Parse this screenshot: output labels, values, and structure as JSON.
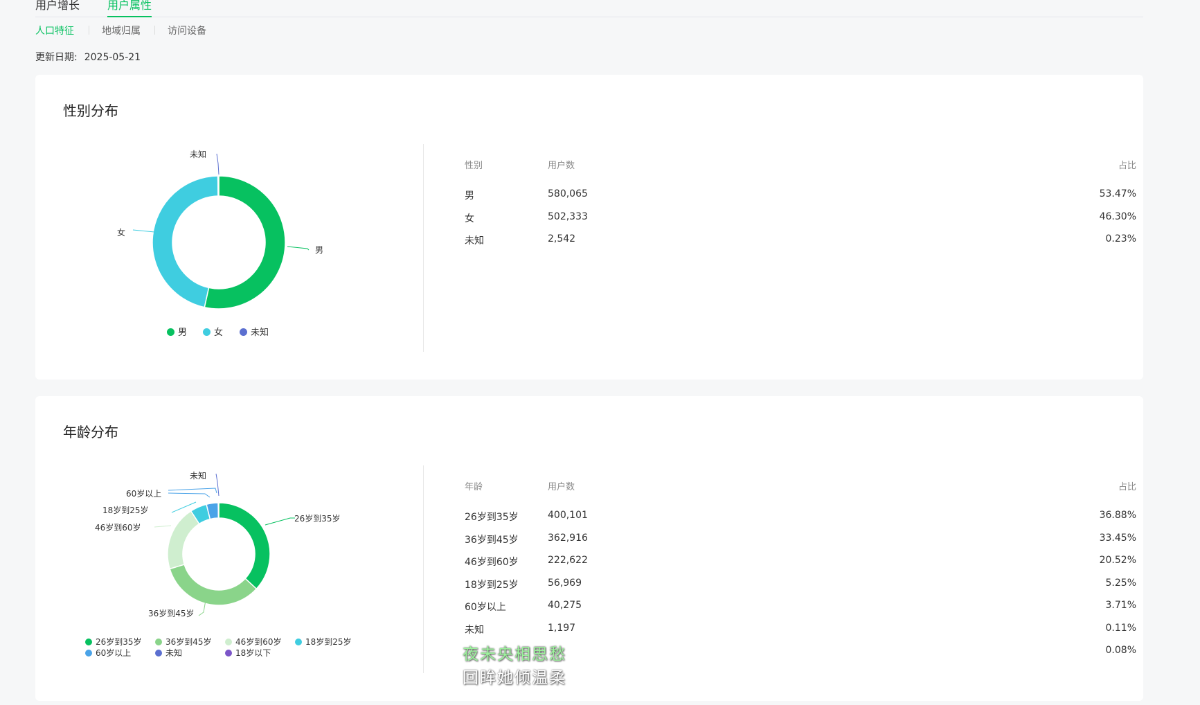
{
  "tabs": [
    {
      "label": "用户增长",
      "active": false
    },
    {
      "label": "用户属性",
      "active": true
    }
  ],
  "subtabs": [
    {
      "label": "人口特征",
      "active": true
    },
    {
      "label": "地域归属",
      "active": false
    },
    {
      "label": "访问设备",
      "active": false
    }
  ],
  "update": {
    "label": "更新日期:",
    "value": "2025-05-21"
  },
  "gender": {
    "title": "性别分布",
    "table": {
      "headers": [
        "性别",
        "用户数",
        "占比"
      ],
      "rows": [
        {
          "label": "男",
          "count": "580,065",
          "pct": "53.47%"
        },
        {
          "label": "女",
          "count": "502,333",
          "pct": "46.30%"
        },
        {
          "label": "未知",
          "count": "2,542",
          "pct": "0.23%"
        }
      ]
    },
    "chart_data": {
      "type": "pie",
      "categories": [
        "男",
        "女",
        "未知"
      ],
      "values": [
        53.47,
        46.3,
        0.23
      ],
      "colors": [
        "#07c160",
        "#3fcde0",
        "#5b6fd0"
      ],
      "legend_placement": "bottom"
    }
  },
  "age": {
    "title": "年龄分布",
    "table": {
      "headers": [
        "年龄",
        "用户数",
        "占比"
      ],
      "rows": [
        {
          "label": "26岁到35岁",
          "count": "400,101",
          "pct": "36.88%"
        },
        {
          "label": "36岁到45岁",
          "count": "362,916",
          "pct": "33.45%"
        },
        {
          "label": "46岁到60岁",
          "count": "222,622",
          "pct": "20.52%"
        },
        {
          "label": "18岁到25岁",
          "count": "56,969",
          "pct": "5.25%"
        },
        {
          "label": "60岁以上",
          "count": "40,275",
          "pct": "3.71%"
        },
        {
          "label": "未知",
          "count": "1,197",
          "pct": "0.11%"
        },
        {
          "label": "",
          "count": "",
          "pct": "0.08%"
        }
      ]
    },
    "chart_data": {
      "type": "pie",
      "categories": [
        "26岁到35岁",
        "36岁到45岁",
        "46岁到60岁",
        "18岁到25岁",
        "60岁以上",
        "未知",
        "18岁以下"
      ],
      "values": [
        36.88,
        33.45,
        20.52,
        5.25,
        3.71,
        0.11,
        0.08
      ],
      "colors": [
        "#07c160",
        "#8ad48a",
        "#cfeecf",
        "#3fcde0",
        "#4aa3e8",
        "#5b6fd0",
        "#7b55c8"
      ],
      "legend_placement": "bottom"
    }
  },
  "overlay": {
    "line1": "夜未央相思愁",
    "line2": "回眸她倾温柔"
  }
}
